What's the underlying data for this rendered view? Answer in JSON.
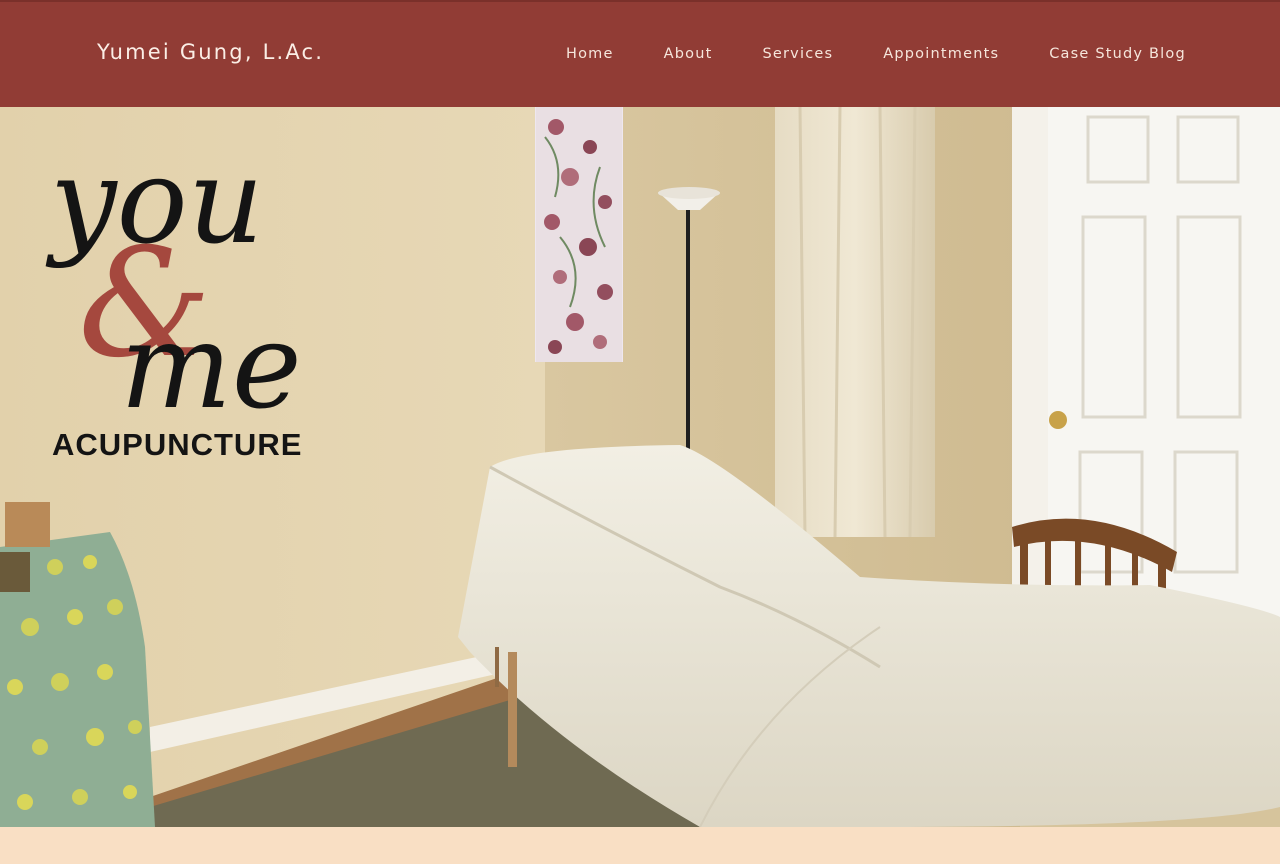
{
  "header": {
    "site_title": "Yumei Gung, L.Ac."
  },
  "nav": {
    "items": [
      {
        "label": "Home"
      },
      {
        "label": "About"
      },
      {
        "label": "Services"
      },
      {
        "label": "Appointments"
      },
      {
        "label": "Case Study Blog"
      }
    ]
  },
  "hero": {
    "logo": {
      "line1": "you",
      "ampersand": "&",
      "line2": "me",
      "tagline": "ACUPUNCTURE"
    }
  },
  "colors": {
    "header_bg": "#913c35",
    "header_text": "#fbeee6",
    "wall": "#e4d3ad",
    "footer_band": "#f9dfc4",
    "logo_accent": "#a5483e"
  }
}
